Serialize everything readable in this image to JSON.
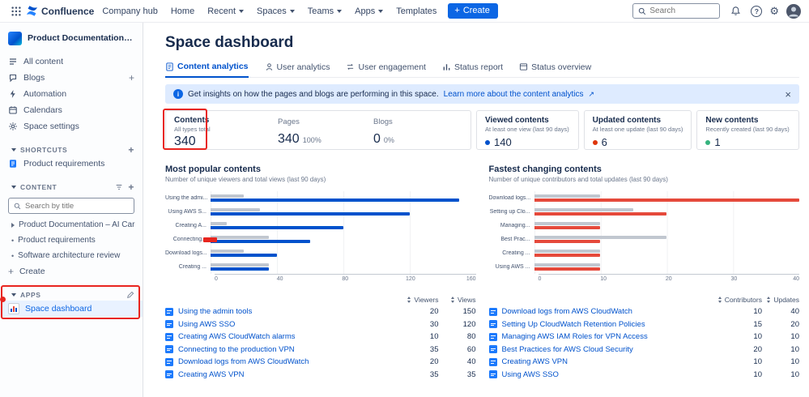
{
  "topbar": {
    "logo_text": "Confluence",
    "nav": {
      "company_hub": "Company hub",
      "home": "Home",
      "recent": "Recent",
      "spaces": "Spaces",
      "teams": "Teams",
      "apps": "Apps",
      "templates": "Templates"
    },
    "create_label": "Create",
    "create_plus": "+",
    "search_placeholder": "Search",
    "help_glyph": "?",
    "gear_glyph": "⚙"
  },
  "sidebar": {
    "space_name": "Product Documentation - AI Car",
    "nav": {
      "all_content": "All content",
      "blogs": "Blogs",
      "automation": "Automation",
      "calendars": "Calendars",
      "space_settings": "Space settings"
    },
    "plus_glyph": "+",
    "shortcuts": {
      "title": "SHORTCUTS",
      "product_requirements": "Product requirements"
    },
    "content": {
      "title": "CONTENT",
      "search_placeholder": "Search by title",
      "tree_item1": "Product Documentation – AI Car",
      "tree_item2": "Product requirements",
      "tree_item3": "Software architecture review",
      "bullet": "•",
      "create_label": "Create"
    },
    "apps": {
      "title": "APPS",
      "space_dashboard": "Space dashboard"
    }
  },
  "main": {
    "title": "Space dashboard",
    "tabs": {
      "t0": "Content analytics",
      "t1": "User analytics",
      "t2": "User engagement",
      "t3": "Status report",
      "t4": "Status overview"
    },
    "banner": {
      "text": "Get insights on how the pages and blogs are performing in this space.",
      "link": "Learn more about the content analytics",
      "external_icon": "↗",
      "close_icon": "×"
    },
    "stats": {
      "contents": {
        "label": "Contents",
        "sub": "All types total",
        "value": "340"
      },
      "pages": {
        "label": "Pages",
        "value": "340",
        "pct": "100%"
      },
      "blogs": {
        "label": "Blogs",
        "value": "0",
        "pct": "0%"
      },
      "viewed": {
        "label": "Viewed contents",
        "sub": "At least one view (last 90 days)",
        "value": "140"
      },
      "updated": {
        "label": "Updated contents",
        "sub": "At least one update (last 90 days)",
        "value": "6"
      },
      "new": {
        "label": "New contents",
        "sub": "Recently created (last 90 days)",
        "value": "1"
      }
    }
  },
  "chart_data": [
    {
      "type": "bar",
      "orientation": "horizontal",
      "title": "Most popular contents",
      "subtitle": "Number of unique viewers and total views (last 90 days)",
      "categories": [
        "Using the admin tools",
        "Using AWS SSO",
        "Creating AWS CloudWatch alarms",
        "Connecting to the production VPN",
        "Download logs from AWS CloudWatch",
        "Creating AWS VPN"
      ],
      "categories_short": [
        "Using the admi...",
        "Using AWS S...",
        "Creating A...",
        "Connecting...",
        "Download logs...",
        "Creating ..."
      ],
      "series": [
        {
          "name": "Viewers",
          "color": "#C1C7D0",
          "values": [
            20,
            30,
            10,
            35,
            20,
            35
          ]
        },
        {
          "name": "Views",
          "color": "#0052CC",
          "values": [
            150,
            120,
            80,
            60,
            40,
            35
          ]
        }
      ],
      "xticks": [
        "0",
        "40",
        "80",
        "120",
        "160"
      ],
      "xmax": 160,
      "grid": true,
      "list": {
        "col1": "Viewers",
        "col2": "Views",
        "rows": [
          {
            "title": "Using the admin tools",
            "v1": "20",
            "v2": "150"
          },
          {
            "title": "Using AWS SSO",
            "v1": "30",
            "v2": "120"
          },
          {
            "title": "Creating AWS CloudWatch alarms",
            "v1": "10",
            "v2": "80"
          },
          {
            "title": "Connecting to the production VPN",
            "v1": "35",
            "v2": "60"
          },
          {
            "title": "Download logs from AWS CloudWatch",
            "v1": "20",
            "v2": "40"
          },
          {
            "title": "Creating AWS VPN",
            "v1": "35",
            "v2": "35"
          }
        ]
      }
    },
    {
      "type": "bar",
      "orientation": "horizontal",
      "title": "Fastest changing contents",
      "subtitle": "Number of unique contributors and total updates (last 90 days)",
      "categories": [
        "Download logs from AWS CloudWatch",
        "Setting Up CloudWatch Retention Policies",
        "Managing AWS IAM Roles for VPN Access",
        "Best Practices for AWS Cloud Security",
        "Creating AWS VPN",
        "Using AWS SSO"
      ],
      "categories_short": [
        "Download logs...",
        "Setting up Clo...",
        "Managing...",
        "Best Prac...",
        "Creating ...",
        "Using AWS ..."
      ],
      "series": [
        {
          "name": "Contributors",
          "color": "#C1C7D0",
          "values": [
            10,
            15,
            10,
            20,
            10,
            10
          ]
        },
        {
          "name": "Updates",
          "color": "#E5493B",
          "values": [
            40,
            20,
            10,
            10,
            10,
            10
          ]
        }
      ],
      "xticks": [
        "0",
        "10",
        "20",
        "30",
        "40"
      ],
      "xmax": 40,
      "grid": true,
      "list": {
        "col1": "Contributors",
        "col2": "Updates",
        "rows": [
          {
            "title": "Download logs from AWS CloudWatch",
            "v1": "10",
            "v2": "40"
          },
          {
            "title": "Setting Up CloudWatch Retention Policies",
            "v1": "15",
            "v2": "20"
          },
          {
            "title": "Managing AWS IAM Roles for VPN Access",
            "v1": "10",
            "v2": "10"
          },
          {
            "title": "Best Practices for AWS Cloud Security",
            "v1": "20",
            "v2": "10"
          },
          {
            "title": "Creating AWS VPN",
            "v1": "10",
            "v2": "10"
          },
          {
            "title": "Using AWS SSO",
            "v1": "10",
            "v2": "10"
          }
        ]
      }
    }
  ],
  "colors": {
    "accent": "#0052CC",
    "create_button": "#0C66E4",
    "banner_bg": "#DEEBFF",
    "viewed_dot": "#0052CC",
    "updated_dot": "#DE350B",
    "new_dot": "#36B37E",
    "views_bar": "#0052CC",
    "neutral_bar": "#C1C7D0",
    "updates_bar": "#E5493B",
    "annotation": "#E8251F"
  }
}
